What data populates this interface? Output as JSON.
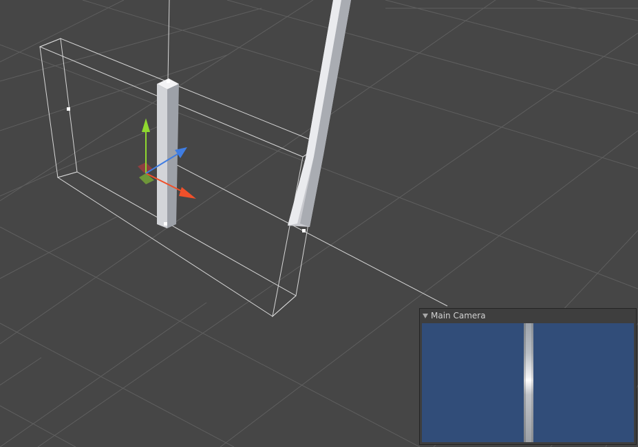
{
  "scene": {
    "background_color": "#464646",
    "grid_color": "#5f5f5f",
    "wireframe_color": "#ffffff",
    "object_colors": {
      "pillar_light": "#d9dadd",
      "pillar_dark": "#9b9ea4"
    }
  },
  "gizmo": {
    "axes": [
      {
        "name": "y",
        "icon": "y-axis-arrow-icon",
        "color": "#8fd92f"
      },
      {
        "name": "x",
        "icon": "x-axis-arrow-icon",
        "color": "#f0502a"
      },
      {
        "name": "z",
        "icon": "z-axis-arrow-icon",
        "color": "#3f7de2"
      }
    ],
    "plane_colors": [
      "#c93b3b",
      "#8fd92f"
    ]
  },
  "camera_preview": {
    "title": "Main Camera",
    "background_color": "#314d79",
    "icon": "foldout-triangle-icon"
  }
}
